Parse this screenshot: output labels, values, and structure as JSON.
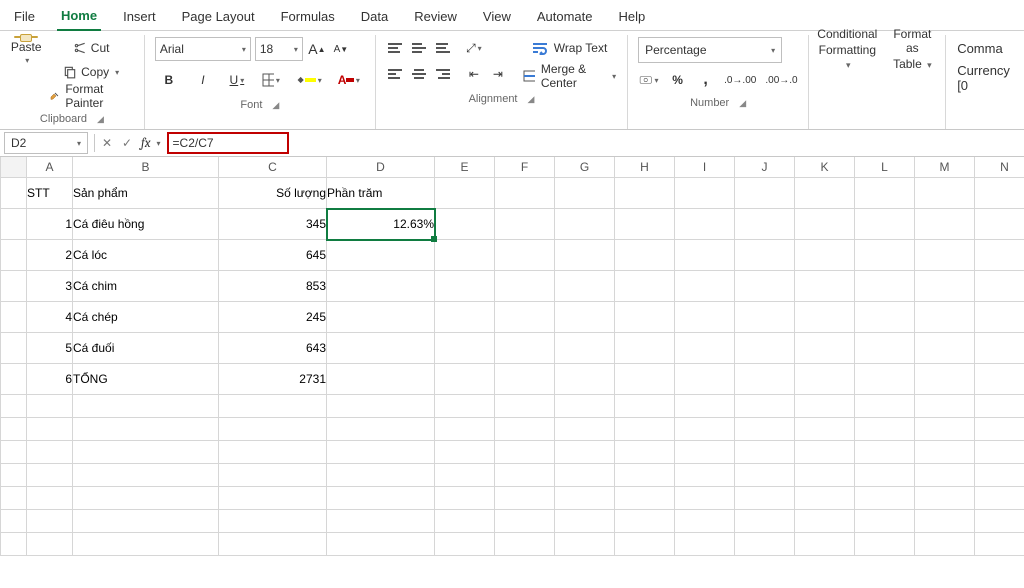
{
  "menu": {
    "tabs": [
      "File",
      "Home",
      "Insert",
      "Page Layout",
      "Formulas",
      "Data",
      "Review",
      "View",
      "Automate",
      "Help"
    ],
    "active": "Home"
  },
  "ribbon": {
    "clipboard": {
      "paste": "Paste",
      "cut": "Cut",
      "copy": "Copy",
      "format_painter": "Format Painter",
      "label": "Clipboard"
    },
    "font": {
      "name": "Arial",
      "size": "18",
      "label": "Font"
    },
    "alignment": {
      "wrap": "Wrap Text",
      "merge": "Merge & Center",
      "label": "Alignment"
    },
    "number": {
      "format": "Percentage",
      "label": "Number"
    },
    "styles": {
      "conditional": "Conditional",
      "formatting_line2": "Formatting",
      "format_as": "Format as",
      "table_line2": "Table"
    },
    "numfmt": {
      "comma": "Comma",
      "currency": "Currency [0"
    }
  },
  "formula_bar": {
    "name_box": "D2",
    "formula": "=C2/C7"
  },
  "columns": [
    "A",
    "B",
    "C",
    "D",
    "E",
    "F",
    "G",
    "H",
    "I",
    "J",
    "K",
    "L",
    "M",
    "N"
  ],
  "headers": {
    "A": "STT",
    "B": "Sản phẩm",
    "C": "Số lượng",
    "D": "Phần trăm"
  },
  "rows": [
    {
      "stt": "1",
      "sp": "Cá điêu hồng",
      "sl": "345",
      "pt": "12.63%"
    },
    {
      "stt": "2",
      "sp": "Cá lóc",
      "sl": "645",
      "pt": ""
    },
    {
      "stt": "3",
      "sp": "Cá chim",
      "sl": "853",
      "pt": ""
    },
    {
      "stt": "4",
      "sp": "Cá chép",
      "sl": "245",
      "pt": ""
    },
    {
      "stt": "5",
      "sp": "Cá đuối",
      "sl": "643",
      "pt": ""
    },
    {
      "stt": "6",
      "sp": "TỔNG",
      "sl": "2731",
      "pt": ""
    }
  ],
  "selected_cell": "D2"
}
